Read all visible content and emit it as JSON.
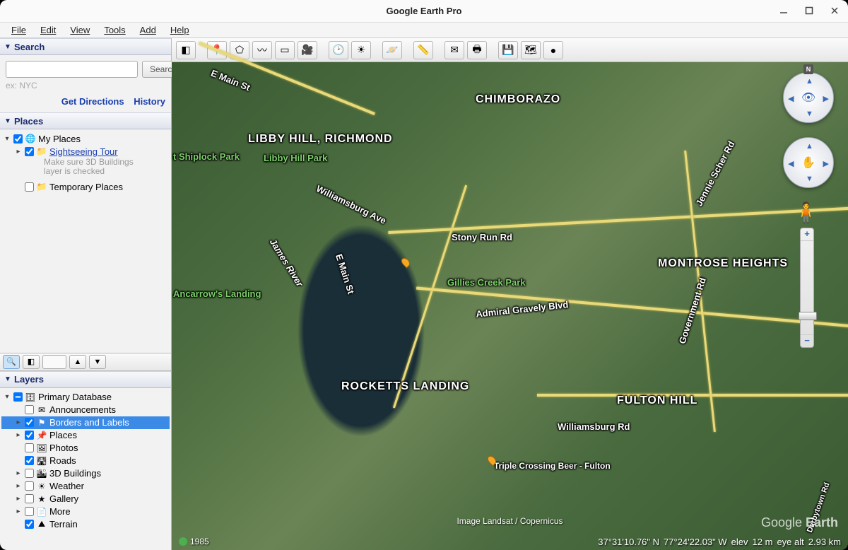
{
  "window": {
    "title": "Google Earth Pro"
  },
  "menu": {
    "file": "File",
    "edit": "Edit",
    "view": "View",
    "tools": "Tools",
    "add": "Add",
    "help": "Help"
  },
  "panels": {
    "search": {
      "title": "Search",
      "button": "Search",
      "hint": "ex: NYC",
      "get_directions": "Get Directions",
      "history": "History"
    },
    "places": {
      "title": "Places",
      "my_places": "My Places",
      "sightseeing": "Sightseeing Tour",
      "sightseeing_note1": "Make sure 3D Buildings",
      "sightseeing_note2": "layer is checked",
      "temporary": "Temporary Places"
    },
    "layers": {
      "title": "Layers",
      "items": [
        {
          "label": "Primary Database",
          "checked": "indeterminate",
          "expandable": true,
          "icon": "database-icon",
          "selected": false,
          "depth": 0
        },
        {
          "label": "Announcements",
          "checked": false,
          "expandable": false,
          "icon": "mail-icon",
          "selected": false,
          "depth": 1
        },
        {
          "label": "Borders and Labels",
          "checked": true,
          "expandable": true,
          "icon": "borders-icon",
          "selected": true,
          "depth": 1
        },
        {
          "label": "Places",
          "checked": true,
          "expandable": true,
          "icon": "pin-icon",
          "selected": false,
          "depth": 1
        },
        {
          "label": "Photos",
          "checked": false,
          "expandable": false,
          "icon": "photos-icon",
          "selected": false,
          "depth": 1
        },
        {
          "label": "Roads",
          "checked": true,
          "expandable": false,
          "icon": "roads-icon",
          "selected": false,
          "depth": 1
        },
        {
          "label": "3D Buildings",
          "checked": false,
          "expandable": true,
          "icon": "buildings-icon",
          "selected": false,
          "depth": 1
        },
        {
          "label": "Weather",
          "checked": false,
          "expandable": true,
          "icon": "weather-icon",
          "selected": false,
          "depth": 1
        },
        {
          "label": "Gallery",
          "checked": false,
          "expandable": true,
          "icon": "gallery-icon",
          "selected": false,
          "depth": 1
        },
        {
          "label": "More",
          "checked": false,
          "expandable": true,
          "icon": "more-icon",
          "selected": false,
          "depth": 1
        },
        {
          "label": "Terrain",
          "checked": true,
          "expandable": false,
          "icon": "terrain-icon",
          "selected": false,
          "depth": 1
        }
      ]
    }
  },
  "toolbar": {
    "items": [
      {
        "name": "hide-sidebar-button",
        "glyph": "◧"
      },
      {
        "sep": true
      },
      {
        "name": "add-placemark-button",
        "glyph": "📍"
      },
      {
        "name": "add-polygon-button",
        "glyph": "⬠"
      },
      {
        "name": "add-path-button",
        "glyph": "〰"
      },
      {
        "name": "add-image-overlay-button",
        "glyph": "▭"
      },
      {
        "name": "record-tour-button",
        "glyph": "🎥"
      },
      {
        "sep": true
      },
      {
        "name": "historical-imagery-button",
        "glyph": "🕑"
      },
      {
        "name": "sunlight-button",
        "glyph": "☀"
      },
      {
        "sep": true
      },
      {
        "name": "planets-button",
        "glyph": "🪐"
      },
      {
        "sep": true
      },
      {
        "name": "ruler-button",
        "glyph": "📏"
      },
      {
        "sep": true
      },
      {
        "name": "email-button",
        "glyph": "✉"
      },
      {
        "name": "print-button",
        "glyph": "🖶"
      },
      {
        "sep": true
      },
      {
        "name": "save-image-button",
        "glyph": "💾"
      },
      {
        "name": "view-in-maps-button",
        "glyph": "🗺"
      },
      {
        "name": "sphere-button",
        "glyph": "●"
      }
    ]
  },
  "map": {
    "labels": {
      "chimborazo": "CHIMBORAZO",
      "libby_hill_richmond": "LIBBY HILL, RICHMOND",
      "libby_hill_park": "Libby Hill Park",
      "shiplock": "t Shiplock Park",
      "e_main_st": "E Main St",
      "williamsburg_ave": "Williamsburg Ave",
      "stony_run_rd": "Stony Run Rd",
      "jennie_scher_rd": "Jennie Scher Rd",
      "james_river": "James River",
      "e_main_st2": "E Main St",
      "ancarrows": "Ancarrow's Landing",
      "gillies": "Gillies Creek Park",
      "admiral": "Admiral Gravely Blvd",
      "government_rd": "Government Rd",
      "montrose": "MONTROSE HEIGHTS",
      "rocketts": "ROCKETTS LANDING",
      "fulton_hill": "FULTON HILL",
      "williamsburg_rd": "Williamsburg Rd",
      "triple_crossing": "Triple Crossing Beer - Fulton",
      "darbytown": "Darbytown Rd"
    },
    "attribution": "Image Landsat / Copernicus",
    "watermark_a": "Google ",
    "watermark_b": "Earth",
    "compass_n": "N"
  },
  "status": {
    "year": "1985",
    "lat": "37°31'10.76\" N",
    "lon": "77°24'22.03\" W",
    "elev_label": "elev",
    "elev": "12 m",
    "eye_label": "eye alt",
    "eye": "2.93 km"
  }
}
